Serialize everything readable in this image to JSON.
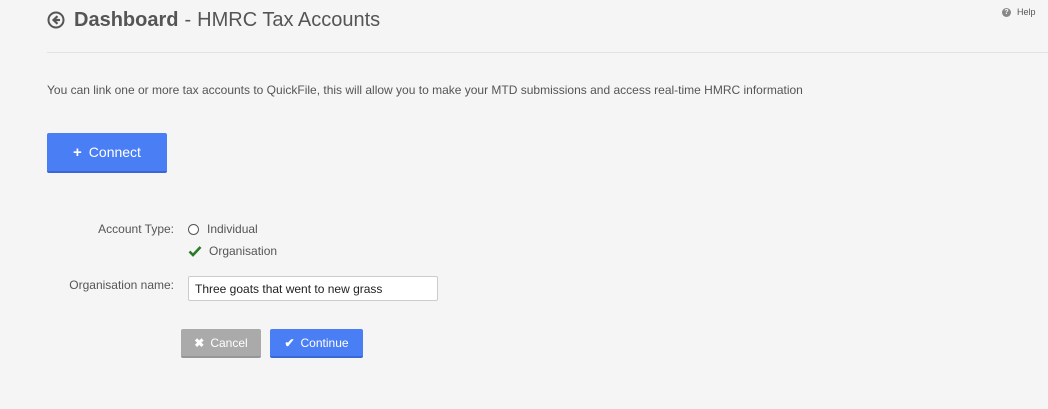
{
  "header": {
    "title": "Dashboard",
    "separator": "-",
    "subtitle": "HMRC Tax Accounts",
    "back_icon": "arrow-circle-left-icon"
  },
  "help": {
    "label": "Help",
    "icon": "question-circle-icon"
  },
  "intro_text": "You can link one or more tax accounts to QuickFile, this will allow you to make your MTD submissions and access real-time HMRC information",
  "connect_button": {
    "label": "Connect",
    "icon": "plus-icon",
    "color": "#4a7ef5"
  },
  "form": {
    "account_type_label": "Account Type:",
    "options": [
      {
        "label": "Individual",
        "selected": false
      },
      {
        "label": "Organisation",
        "selected": true
      }
    ],
    "org_name_label": "Organisation name:",
    "org_name_value": "Three goats that went to new grass",
    "check_color": "#2a7a2a"
  },
  "actions": {
    "cancel_label": "Cancel",
    "cancel_icon": "times-icon",
    "continue_label": "Continue",
    "continue_icon": "check-icon"
  }
}
